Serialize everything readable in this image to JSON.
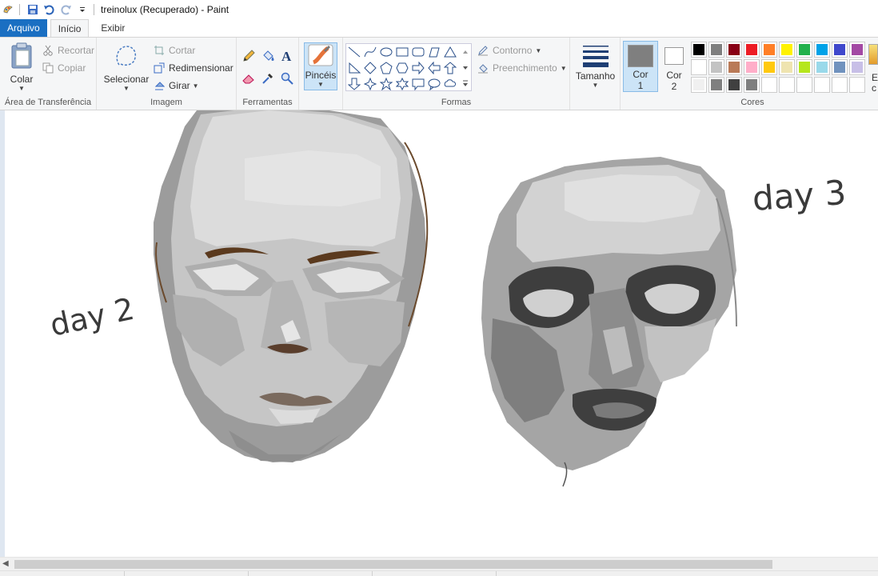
{
  "window": {
    "title": "treinolux (Recuperado) - Paint"
  },
  "tabs": {
    "file": "Arquivo",
    "home": "Início",
    "view": "Exibir"
  },
  "clipboard": {
    "paste": "Colar",
    "cut": "Recortar",
    "copy": "Copiar",
    "label": "Área de Transferência"
  },
  "image": {
    "select": "Selecionar",
    "crop": "Cortar",
    "resize": "Redimensionar",
    "rotate": "Girar",
    "label": "Imagem"
  },
  "tools": {
    "label": "Ferramentas",
    "brushes": "Pincéis"
  },
  "shapes": {
    "outline": "Contorno",
    "fill": "Preenchimento",
    "label": "Formas"
  },
  "size": {
    "label": "Tamanho"
  },
  "colors": {
    "color1_label": "Cor",
    "color1_num": "1",
    "color2_label": "Cor",
    "color2_num": "2",
    "label": "Cores",
    "edit_partial": "Ed c",
    "color1_value": "#7f7f7f",
    "color2_value": "#ffffff",
    "palette_row1": [
      "#000000",
      "#7f7f7f",
      "#880015",
      "#ed1c24",
      "#ff7f27",
      "#fff200",
      "#22b14c",
      "#00a2e8",
      "#3f48cc",
      "#a349a4"
    ],
    "palette_row2": [
      "#ffffff",
      "#c3c3c3",
      "#b97a57",
      "#ffaec9",
      "#ffc90e",
      "#efe4b0",
      "#b5e61d",
      "#99d9ea",
      "#7092be",
      "#c8bfe7"
    ],
    "palette_row3": [
      "#f0f0f0",
      "#7f7f7f",
      "#404040",
      "#7f7f7f",
      "",
      "",
      "",
      "",
      "",
      ""
    ]
  },
  "canvas": {
    "label_left": "day 2",
    "label_right": "day 3"
  }
}
